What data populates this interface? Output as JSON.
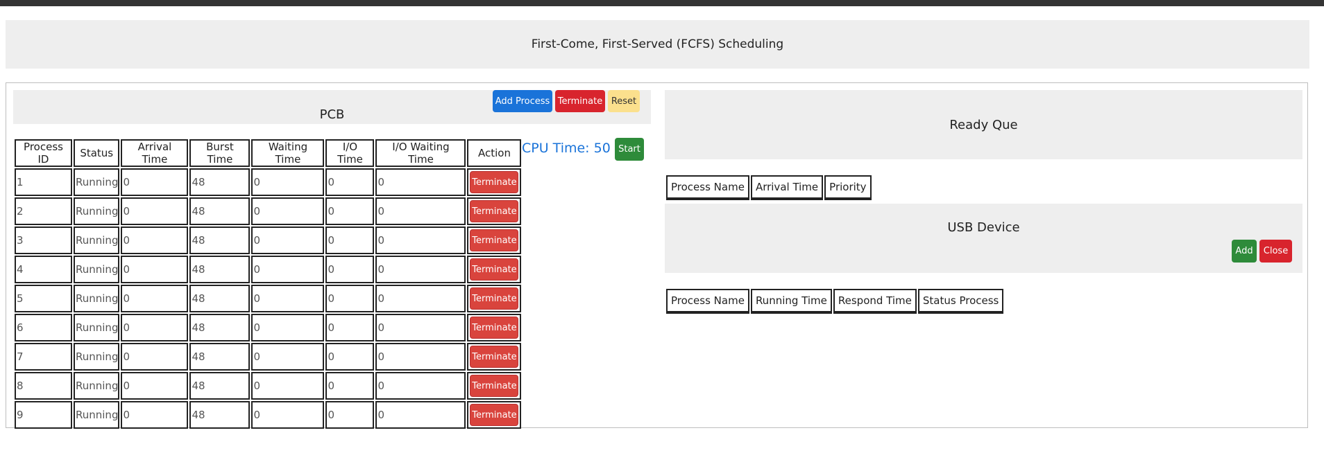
{
  "page": {
    "title": "First-Come, First-Served (FCFS) Scheduling"
  },
  "pcb": {
    "title": "PCB",
    "buttons": {
      "add_process": "Add Process",
      "terminate": "Terminate",
      "reset": "Reset"
    },
    "columns": [
      "Process ID",
      "Status",
      "Arrival Time",
      "Burst Time",
      "Waiting Time",
      "I/O Time",
      "I/O Waiting Time",
      "Action"
    ],
    "rows": [
      [
        "1",
        "Running",
        "0",
        "48",
        "0",
        "0",
        "0"
      ],
      [
        "2",
        "Running",
        "0",
        "48",
        "0",
        "0",
        "0"
      ],
      [
        "3",
        "Running",
        "0",
        "48",
        "0",
        "0",
        "0"
      ],
      [
        "4",
        "Running",
        "0",
        "48",
        "0",
        "0",
        "0"
      ],
      [
        "5",
        "Running",
        "0",
        "48",
        "0",
        "0",
        "0"
      ],
      [
        "6",
        "Running",
        "0",
        "48",
        "0",
        "0",
        "0"
      ],
      [
        "7",
        "Running",
        "0",
        "48",
        "0",
        "0",
        "0"
      ],
      [
        "8",
        "Running",
        "0",
        "48",
        "0",
        "0",
        "0"
      ],
      [
        "9",
        "Running",
        "0",
        "48",
        "0",
        "0",
        "0"
      ]
    ],
    "row_action_label": "Terminate"
  },
  "cpu": {
    "time_label": "CPU Time: 50",
    "start_label": "Start"
  },
  "ready_queue": {
    "title": "Ready Que",
    "columns": [
      "Process Name",
      "Arrival Time",
      "Priority"
    ]
  },
  "usb": {
    "title": "USB Device",
    "add_label": "Add",
    "close_label": "Close",
    "columns": [
      "Process Name",
      "Running Time",
      "Respond Time",
      "Status Process"
    ]
  },
  "colors": {
    "primary": "#1a73d9",
    "danger": "#d8242d",
    "warning": "#fbe08d",
    "success": "#2e8b3a",
    "panel": "#eeeeee"
  }
}
